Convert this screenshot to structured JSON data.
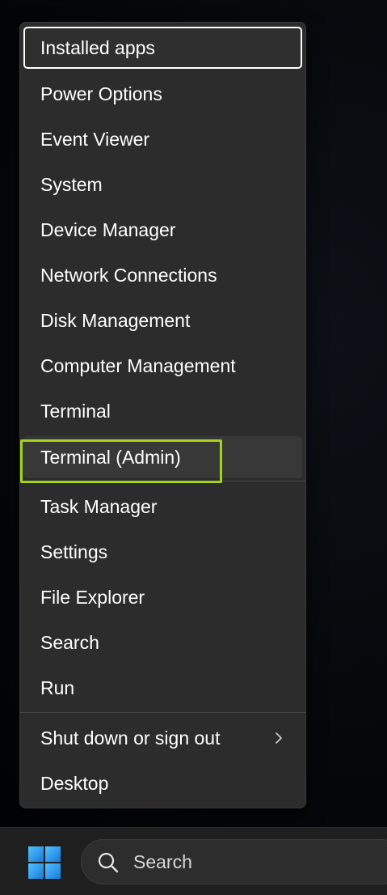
{
  "menu": {
    "items": [
      {
        "label": "Installed apps"
      },
      {
        "label": "Power Options"
      },
      {
        "label": "Event Viewer"
      },
      {
        "label": "System"
      },
      {
        "label": "Device Manager"
      },
      {
        "label": "Network Connections"
      },
      {
        "label": "Disk Management"
      },
      {
        "label": "Computer Management"
      },
      {
        "label": "Terminal"
      },
      {
        "label": "Terminal (Admin)"
      },
      {
        "label": "Task Manager"
      },
      {
        "label": "Settings"
      },
      {
        "label": "File Explorer"
      },
      {
        "label": "Search"
      },
      {
        "label": "Run"
      },
      {
        "label": "Shut down or sign out"
      },
      {
        "label": "Desktop"
      }
    ]
  },
  "taskbar": {
    "search_label": "Search"
  },
  "colors": {
    "menu_bg": "#2c2c2c",
    "highlight": "#a4d41a",
    "start_blue": "#3aa0f0"
  }
}
